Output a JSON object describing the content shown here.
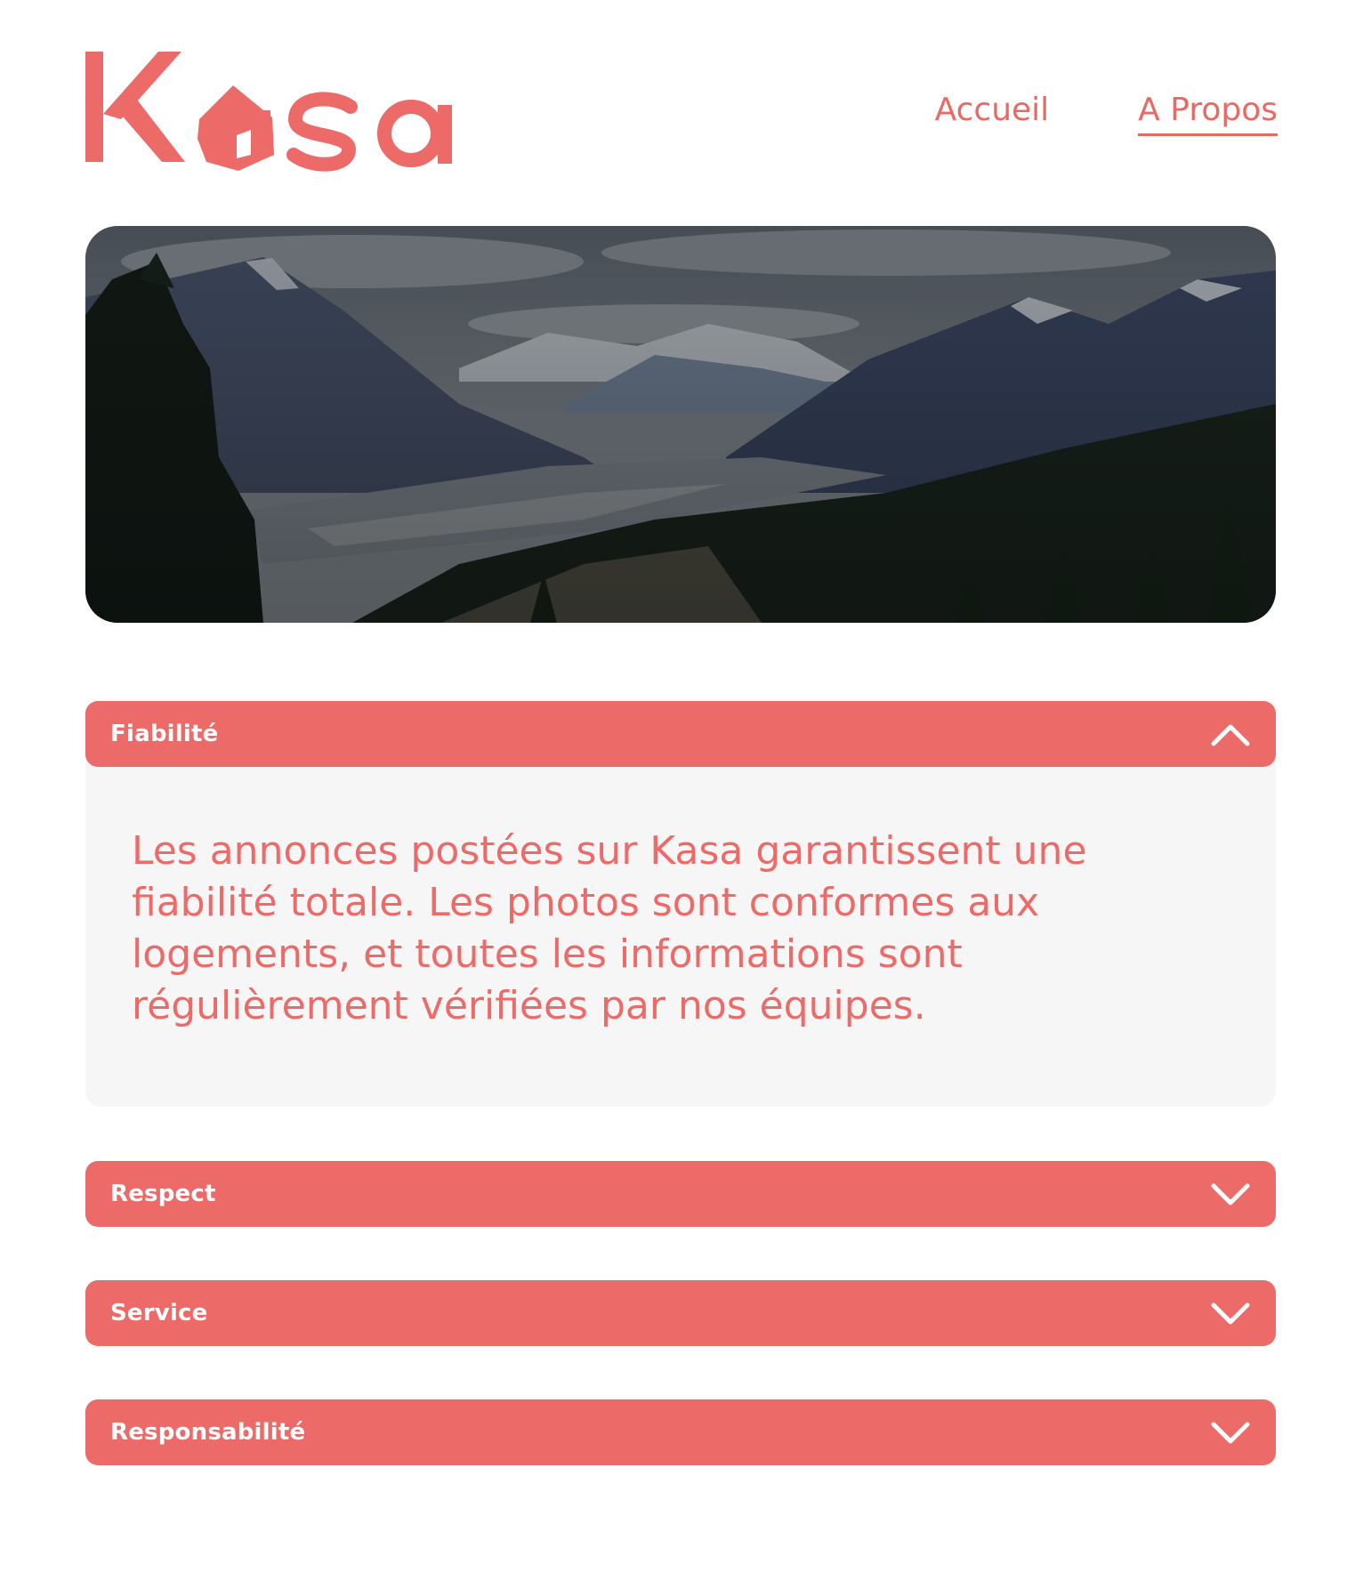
{
  "brand": {
    "name": "Kasa",
    "accent_color": "#EC6A67"
  },
  "nav": {
    "items": [
      {
        "label": "Accueil",
        "active": false
      },
      {
        "label": "A Propos",
        "active": true
      }
    ]
  },
  "banner": {
    "image": "mountain-valley-landscape"
  },
  "accordion": [
    {
      "title": "Fiabilité",
      "expanded": true,
      "icon": "chevron-up-icon",
      "body": "Les annonces postées sur Kasa garantissent une fiabilité totale. Les photos sont conformes aux logements, et toutes les informations sont régulièrement vérifiées par nos équipes."
    },
    {
      "title": "Respect",
      "expanded": false,
      "icon": "chevron-down-icon"
    },
    {
      "title": "Service",
      "expanded": false,
      "icon": "chevron-down-icon"
    },
    {
      "title": "Responsabilité",
      "expanded": false,
      "icon": "chevron-down-icon"
    }
  ]
}
